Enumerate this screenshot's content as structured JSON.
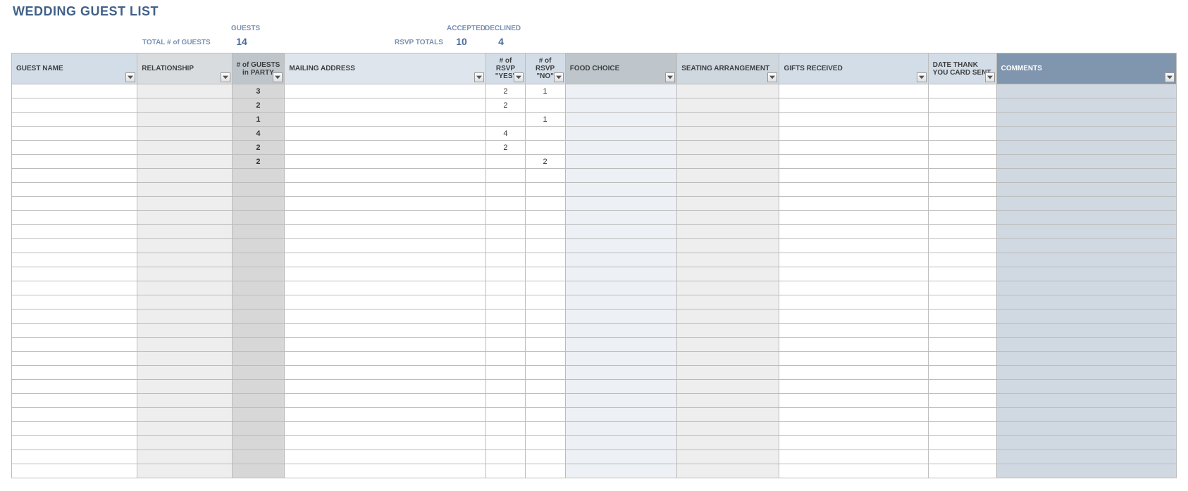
{
  "title": "WEDDING GUEST LIST",
  "summary": {
    "guests_label": "GUESTS",
    "total_label": "TOTAL # of GUESTS",
    "total_value": "14",
    "accepted_label": "ACCEPTED",
    "declined_label": "DECLINED",
    "rsvp_totals_label": "RSVP TOTALS",
    "accepted_value": "10",
    "declined_value": "4"
  },
  "headers": {
    "guest_name": "GUEST NAME",
    "relationship": "RELATIONSHIP",
    "guests_in_party": "# of GUESTS in PARTY",
    "mailing_address": "MAILING ADDRESS",
    "rsvp_yes": "# of RSVP \"YES\"",
    "rsvp_no": "# of RSVP \"NO\"",
    "food_choice": "FOOD CHOICE",
    "seating": "SEATING ARRANGEMENT",
    "gifts": "GIFTS RECEIVED",
    "thank_you": "DATE THANK YOU CARD SENT",
    "comments": "COMMENTS"
  },
  "rows": [
    {
      "guest_name": "",
      "relationship": "",
      "party": "3",
      "mail": "",
      "yes": "2",
      "no": "1",
      "food": "",
      "seat": "",
      "gift": "",
      "thank": "",
      "comment": ""
    },
    {
      "guest_name": "",
      "relationship": "",
      "party": "2",
      "mail": "",
      "yes": "2",
      "no": "",
      "food": "",
      "seat": "",
      "gift": "",
      "thank": "",
      "comment": ""
    },
    {
      "guest_name": "",
      "relationship": "",
      "party": "1",
      "mail": "",
      "yes": "",
      "no": "1",
      "food": "",
      "seat": "",
      "gift": "",
      "thank": "",
      "comment": ""
    },
    {
      "guest_name": "",
      "relationship": "",
      "party": "4",
      "mail": "",
      "yes": "4",
      "no": "",
      "food": "",
      "seat": "",
      "gift": "",
      "thank": "",
      "comment": ""
    },
    {
      "guest_name": "",
      "relationship": "",
      "party": "2",
      "mail": "",
      "yes": "2",
      "no": "",
      "food": "",
      "seat": "",
      "gift": "",
      "thank": "",
      "comment": ""
    },
    {
      "guest_name": "",
      "relationship": "",
      "party": "2",
      "mail": "",
      "yes": "",
      "no": "2",
      "food": "",
      "seat": "",
      "gift": "",
      "thank": "",
      "comment": ""
    },
    {
      "guest_name": "",
      "relationship": "",
      "party": "",
      "mail": "",
      "yes": "",
      "no": "",
      "food": "",
      "seat": "",
      "gift": "",
      "thank": "",
      "comment": ""
    },
    {
      "guest_name": "",
      "relationship": "",
      "party": "",
      "mail": "",
      "yes": "",
      "no": "",
      "food": "",
      "seat": "",
      "gift": "",
      "thank": "",
      "comment": ""
    },
    {
      "guest_name": "",
      "relationship": "",
      "party": "",
      "mail": "",
      "yes": "",
      "no": "",
      "food": "",
      "seat": "",
      "gift": "",
      "thank": "",
      "comment": ""
    },
    {
      "guest_name": "",
      "relationship": "",
      "party": "",
      "mail": "",
      "yes": "",
      "no": "",
      "food": "",
      "seat": "",
      "gift": "",
      "thank": "",
      "comment": ""
    },
    {
      "guest_name": "",
      "relationship": "",
      "party": "",
      "mail": "",
      "yes": "",
      "no": "",
      "food": "",
      "seat": "",
      "gift": "",
      "thank": "",
      "comment": ""
    },
    {
      "guest_name": "",
      "relationship": "",
      "party": "",
      "mail": "",
      "yes": "",
      "no": "",
      "food": "",
      "seat": "",
      "gift": "",
      "thank": "",
      "comment": ""
    },
    {
      "guest_name": "",
      "relationship": "",
      "party": "",
      "mail": "",
      "yes": "",
      "no": "",
      "food": "",
      "seat": "",
      "gift": "",
      "thank": "",
      "comment": ""
    },
    {
      "guest_name": "",
      "relationship": "",
      "party": "",
      "mail": "",
      "yes": "",
      "no": "",
      "food": "",
      "seat": "",
      "gift": "",
      "thank": "",
      "comment": ""
    },
    {
      "guest_name": "",
      "relationship": "",
      "party": "",
      "mail": "",
      "yes": "",
      "no": "",
      "food": "",
      "seat": "",
      "gift": "",
      "thank": "",
      "comment": ""
    },
    {
      "guest_name": "",
      "relationship": "",
      "party": "",
      "mail": "",
      "yes": "",
      "no": "",
      "food": "",
      "seat": "",
      "gift": "",
      "thank": "",
      "comment": ""
    },
    {
      "guest_name": "",
      "relationship": "",
      "party": "",
      "mail": "",
      "yes": "",
      "no": "",
      "food": "",
      "seat": "",
      "gift": "",
      "thank": "",
      "comment": ""
    },
    {
      "guest_name": "",
      "relationship": "",
      "party": "",
      "mail": "",
      "yes": "",
      "no": "",
      "food": "",
      "seat": "",
      "gift": "",
      "thank": "",
      "comment": ""
    },
    {
      "guest_name": "",
      "relationship": "",
      "party": "",
      "mail": "",
      "yes": "",
      "no": "",
      "food": "",
      "seat": "",
      "gift": "",
      "thank": "",
      "comment": ""
    },
    {
      "guest_name": "",
      "relationship": "",
      "party": "",
      "mail": "",
      "yes": "",
      "no": "",
      "food": "",
      "seat": "",
      "gift": "",
      "thank": "",
      "comment": ""
    },
    {
      "guest_name": "",
      "relationship": "",
      "party": "",
      "mail": "",
      "yes": "",
      "no": "",
      "food": "",
      "seat": "",
      "gift": "",
      "thank": "",
      "comment": ""
    },
    {
      "guest_name": "",
      "relationship": "",
      "party": "",
      "mail": "",
      "yes": "",
      "no": "",
      "food": "",
      "seat": "",
      "gift": "",
      "thank": "",
      "comment": ""
    },
    {
      "guest_name": "",
      "relationship": "",
      "party": "",
      "mail": "",
      "yes": "",
      "no": "",
      "food": "",
      "seat": "",
      "gift": "",
      "thank": "",
      "comment": ""
    },
    {
      "guest_name": "",
      "relationship": "",
      "party": "",
      "mail": "",
      "yes": "",
      "no": "",
      "food": "",
      "seat": "",
      "gift": "",
      "thank": "",
      "comment": ""
    },
    {
      "guest_name": "",
      "relationship": "",
      "party": "",
      "mail": "",
      "yes": "",
      "no": "",
      "food": "",
      "seat": "",
      "gift": "",
      "thank": "",
      "comment": ""
    },
    {
      "guest_name": "",
      "relationship": "",
      "party": "",
      "mail": "",
      "yes": "",
      "no": "",
      "food": "",
      "seat": "",
      "gift": "",
      "thank": "",
      "comment": ""
    },
    {
      "guest_name": "",
      "relationship": "",
      "party": "",
      "mail": "",
      "yes": "",
      "no": "",
      "food": "",
      "seat": "",
      "gift": "",
      "thank": "",
      "comment": ""
    },
    {
      "guest_name": "",
      "relationship": "",
      "party": "",
      "mail": "",
      "yes": "",
      "no": "",
      "food": "",
      "seat": "",
      "gift": "",
      "thank": "",
      "comment": ""
    }
  ]
}
